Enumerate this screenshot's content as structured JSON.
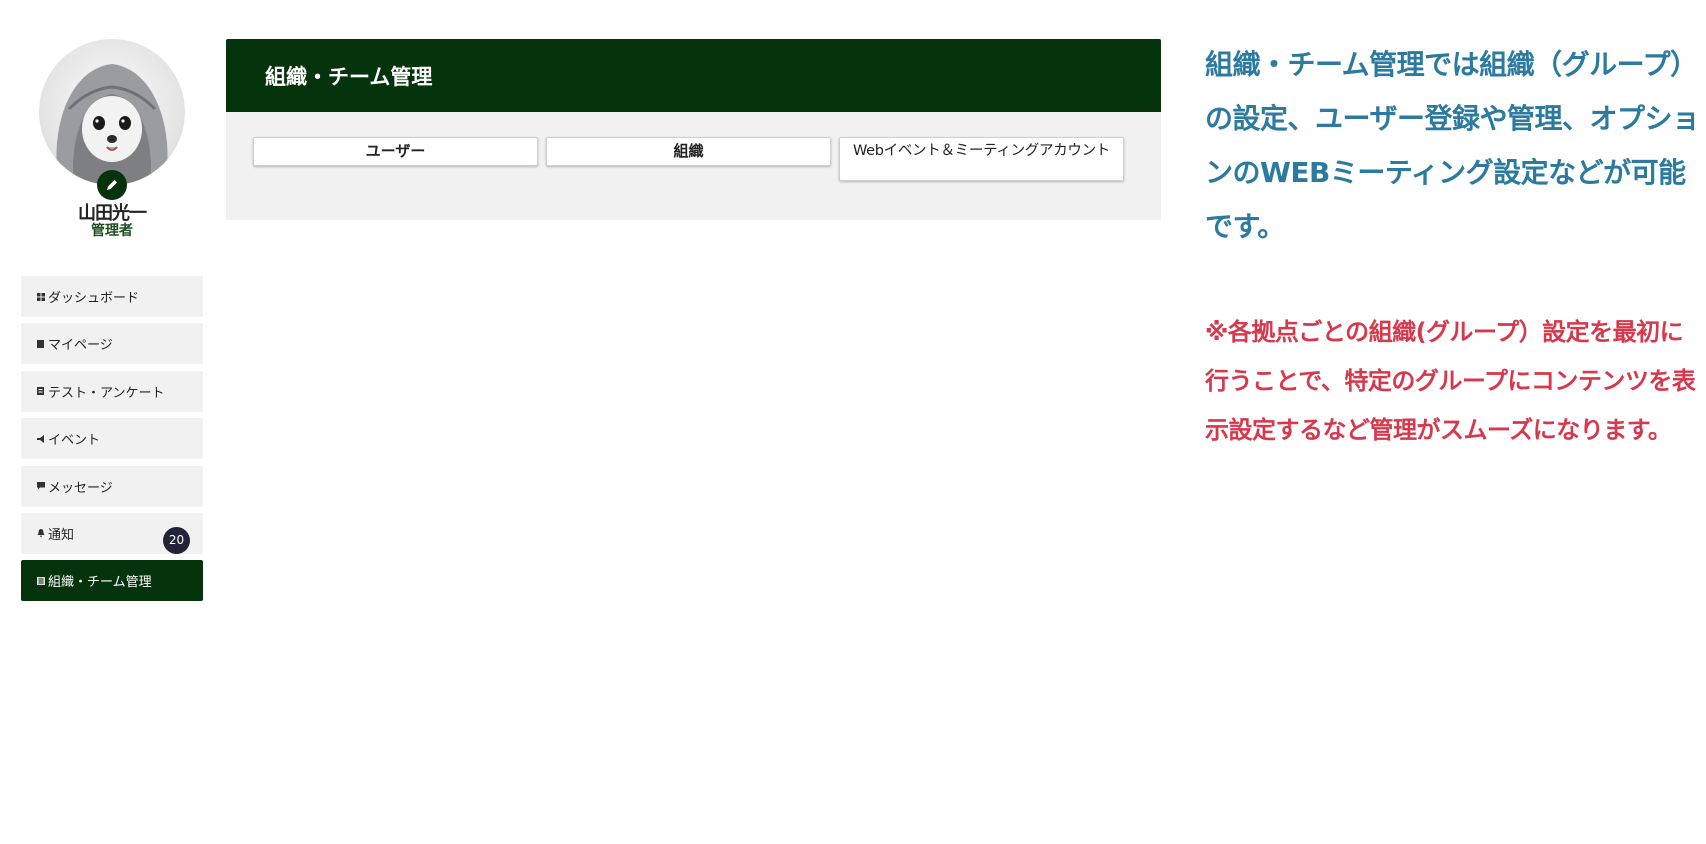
{
  "profile": {
    "name": "山田光一",
    "role": "管理者"
  },
  "sidebar": {
    "items": [
      {
        "label": "ダッシュボード",
        "icon": "dashboard-icon"
      },
      {
        "label": "マイページ",
        "icon": "page-icon"
      },
      {
        "label": "テスト・アンケート",
        "icon": "test-icon"
      },
      {
        "label": "イベント",
        "icon": "megaphone-icon"
      },
      {
        "label": "メッセージ",
        "icon": "message-icon"
      },
      {
        "label": "通知",
        "icon": "bell-icon",
        "badge": "20"
      },
      {
        "label": "組織・チーム管理",
        "icon": "team-icon",
        "active": true
      }
    ]
  },
  "panel": {
    "title": "組織・チーム管理",
    "tabs": [
      {
        "label": "ユーザー"
      },
      {
        "label": "組織"
      },
      {
        "label": "Webイベント＆ミーティングアカウント"
      }
    ]
  },
  "notes": {
    "blue": "組織・チーム管理では組織（グループ）の設定、ユーザー登録や管理、オプションのWEBミーティング設定などが可能です。",
    "red": "※各拠点ごとの組織(グループ）設定を最初に行うことで、特定のグループにコンテンツを表示設定するなど管理がスムーズになります。"
  },
  "colors": {
    "brand_green": "#05330b",
    "note_blue": "#2c7a9f",
    "note_red": "#d6384c",
    "badge_dark": "#232338"
  }
}
